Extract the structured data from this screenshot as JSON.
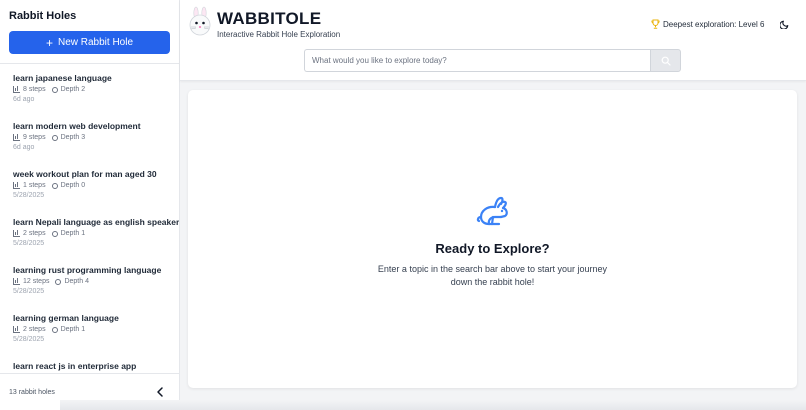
{
  "sidebar": {
    "title": "Rabbit Holes",
    "new_button_icon": "plus-icon",
    "new_button_label": "New Rabbit Hole",
    "items": [
      {
        "title": "learn japanese language",
        "steps": "8 steps",
        "depth": "Depth 2",
        "date": "6d ago"
      },
      {
        "title": "learn modern web development",
        "steps": "9 steps",
        "depth": "Depth 3",
        "date": "6d ago"
      },
      {
        "title": "week workout plan for man aged 30",
        "steps": "1 steps",
        "depth": "Depth 0",
        "date": "5/28/2025"
      },
      {
        "title": "learn Nepali language as english speaker",
        "steps": "2 steps",
        "depth": "Depth 1",
        "date": "5/28/2025"
      },
      {
        "title": "learning rust programming language",
        "steps": "12 steps",
        "depth": "Depth 4",
        "date": "5/28/2025"
      },
      {
        "title": "learning german language",
        "steps": "2 steps",
        "depth": "Depth 1",
        "date": "5/28/2025"
      },
      {
        "title": "learn react js in enterprise app",
        "steps": "",
        "depth": "",
        "date": ""
      }
    ],
    "footer_count": "13 rabbit holes"
  },
  "header": {
    "brand": "WABBITOLE",
    "tagline": "Interactive Rabbit Hole Exploration",
    "deepest": "Deepest exploration: Level 6",
    "search_placeholder": "What would you like to explore today?"
  },
  "main": {
    "title": "Ready to Explore?",
    "description": "Enter a topic in the search bar above to start your journey down the rabbit hole!"
  },
  "colors": {
    "accent": "#2563eb",
    "trophy": "#eab308"
  }
}
